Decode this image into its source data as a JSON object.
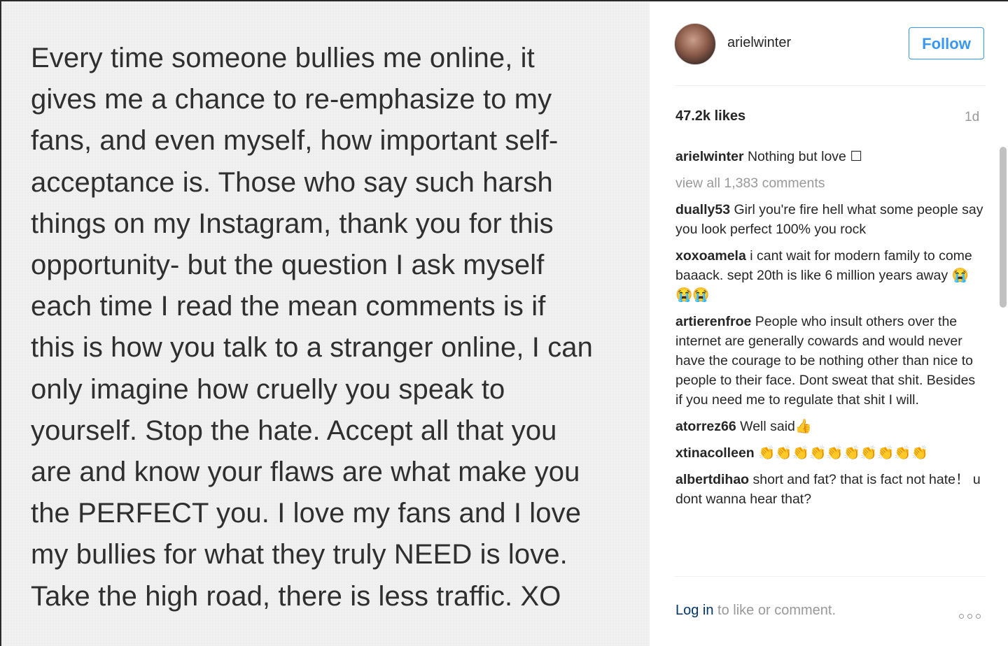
{
  "post": {
    "lines": [
      "Every time someone bullies me online, it",
      "gives me a chance to re-emphasize to my",
      "fans, and even myself, how important self-",
      "acceptance is. Those who say such harsh",
      "things on my Instagram, thank you for this",
      "opportunity- but the question I ask myself",
      "each time I read the mean comments is if",
      "this is how you talk to a stranger online, I can",
      "only imagine how cruelly you speak to",
      "yourself. Stop the hate. Accept all that you",
      "are and know your flaws are what make you",
      "the PERFECT you. I love my fans and I love",
      "my bullies for what they truly NEED is love.",
      "Take the high road, there is less traffic. XO"
    ]
  },
  "header": {
    "username": "arielwinter",
    "follow_label": "Follow"
  },
  "stats": {
    "likes": "47.2k likes",
    "time": "1d"
  },
  "caption": {
    "user": "arielwinter",
    "text": "Nothing but love ☐"
  },
  "view_all": "view all 1,383 comments",
  "comments": [
    {
      "user": "dually53",
      "text": "Girl you're fire hell what some people say you look perfect 100% you rock"
    },
    {
      "user": "xoxoamela",
      "text": "i cant wait for modern family to come baaack. sept 20th is like 6 million years away 😭😭😭"
    },
    {
      "user": "artierenfroe",
      "text": "People who insult others over the internet are generally cowards and would never have the courage to be nothing other than nice to people to their face. Dont sweat that shit. Besides if you need me to regulate that shit I will."
    },
    {
      "user": "atorrez66",
      "text": "Well said👍"
    },
    {
      "user": "xtinacolleen",
      "text": "👏👏👏👏👏👏👏👏👏👏"
    },
    {
      "user": "albertdihao",
      "text": "short and fat?  that is fact not hate！ u dont wanna hear that?"
    }
  ],
  "footer": {
    "login_label": "Log in",
    "rest_label": " to like or comment."
  },
  "icons": {
    "more": "more-options-icon"
  }
}
